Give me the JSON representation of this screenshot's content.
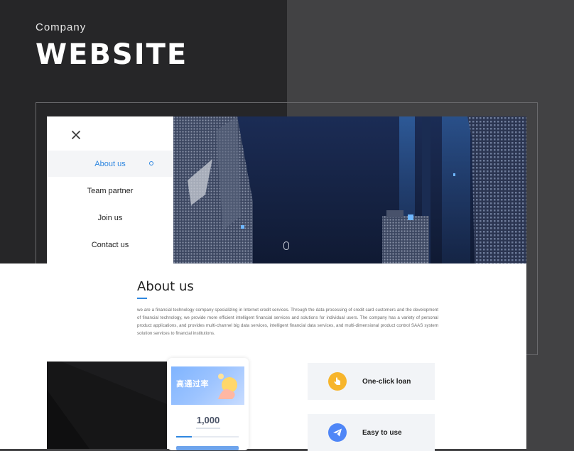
{
  "cover": {
    "subtitle": "Company",
    "title": "WEBSITE"
  },
  "menu": {
    "items": [
      {
        "label": "About us",
        "active": true
      },
      {
        "label": "Team partner",
        "active": false
      },
      {
        "label": "Join us",
        "active": false
      },
      {
        "label": "Contact us",
        "active": false
      }
    ]
  },
  "about": {
    "title": "About us",
    "body": "we are a financial technology company specializing in Internet credit services. Through the data processing of credit card customers and the development of financial technology, we provide more efficient intelligent financial services and solutions for individual users. The company has a variety of personal product applications, and provides multi-channel big data services, intelligent financial data services, and multi-dimensional product control SAAS system solution services to financial institutions."
  },
  "phone": {
    "banner_title": "高通过率",
    "amount": "1,000"
  },
  "features": [
    {
      "label": "One-click loan",
      "icon": "hand-pointer-icon",
      "color": "#f7b52c"
    },
    {
      "label": "Easy to use",
      "icon": "paper-plane-icon",
      "color": "#4f86f7"
    }
  ],
  "colors": {
    "accent": "#2f87e0",
    "dark_bg": "#262628",
    "mid_bg": "#424244"
  }
}
